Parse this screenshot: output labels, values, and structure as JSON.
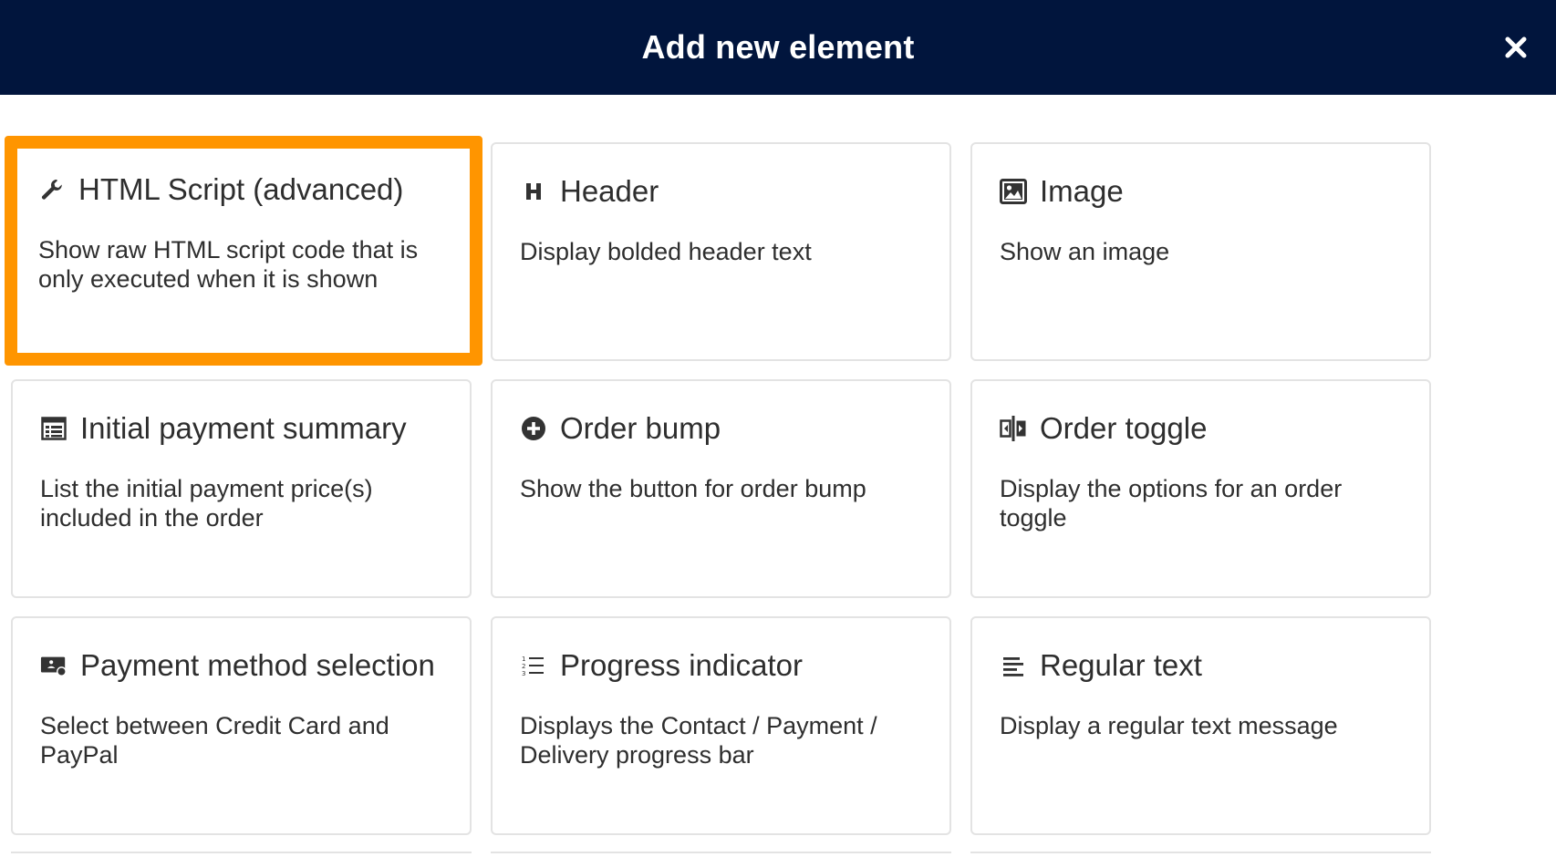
{
  "dialog": {
    "title": "Add new element",
    "close_icon": "close-icon"
  },
  "elements": [
    {
      "title": "HTML Script (advanced)",
      "description": "Show raw HTML script code that is only executed when it is shown",
      "icon": "wrench-icon",
      "selected": true
    },
    {
      "title": "Header",
      "description": "Display bolded header text",
      "icon": "header-icon"
    },
    {
      "title": "Image",
      "description": "Show an image",
      "icon": "image-icon"
    },
    {
      "title": "Initial payment summary",
      "description": "List the initial payment price(s) included in the order",
      "icon": "table-icon"
    },
    {
      "title": "Order bump",
      "description": "Show the button for order bump",
      "icon": "plus-circle-icon"
    },
    {
      "title": "Order toggle",
      "description": "Display the options for an order toggle",
      "icon": "toggle-icon"
    },
    {
      "title": "Payment method selection",
      "description": "Select between Credit Card and PayPal",
      "icon": "payment-icon"
    },
    {
      "title": "Progress indicator",
      "description": "Displays the Contact / Payment / Delivery progress bar",
      "icon": "numbered-list-icon"
    },
    {
      "title": "Regular text",
      "description": "Display a regular text message",
      "icon": "text-align-icon"
    }
  ],
  "colors": {
    "header_bg": "#01153d",
    "selected_border": "#ff9500",
    "card_border": "#e3e3e3"
  }
}
